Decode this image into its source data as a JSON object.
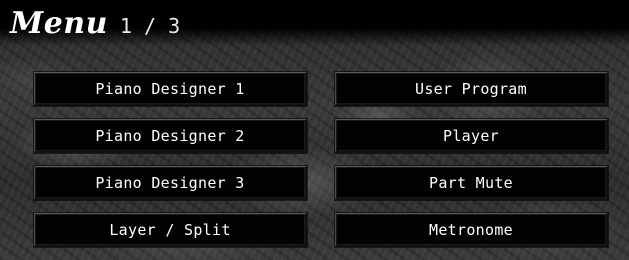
{
  "header": {
    "title": "Menu",
    "page_indicator": "1 / 3"
  },
  "menu": {
    "items": [
      {
        "label": "Piano Designer 1"
      },
      {
        "label": "User Program"
      },
      {
        "label": "Piano Designer 2"
      },
      {
        "label": "Player"
      },
      {
        "label": "Piano Designer 3"
      },
      {
        "label": "Part Mute"
      },
      {
        "label": "Layer / Split"
      },
      {
        "label": "Metronome"
      }
    ]
  },
  "colors": {
    "button_bg": "#020202",
    "text": "#ffffff"
  }
}
